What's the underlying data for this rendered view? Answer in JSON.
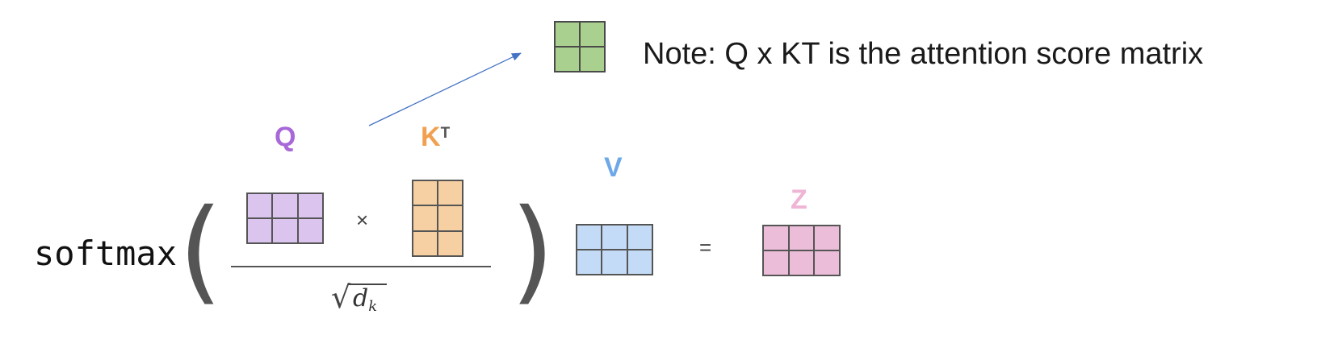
{
  "note": {
    "text": "Note: Q x KT is the attention score matrix",
    "matrix": {
      "rows": 2,
      "cols": 2,
      "color": "#a9d08e"
    }
  },
  "formula": {
    "function": "softmax",
    "multiply_symbol": "×",
    "equals_symbol": "=",
    "open_paren": "(",
    "close_paren": ")",
    "sqrt_symbol": "√",
    "denominator_var": "d",
    "denominator_sub": "k"
  },
  "matrices": {
    "q": {
      "label": "Q",
      "rows": 2,
      "cols": 3,
      "color": "#dbc5ef",
      "label_color": "#a868d8"
    },
    "k": {
      "label": "K",
      "label_sup": "T",
      "rows": 3,
      "cols": 2,
      "color": "#f6d0a2",
      "label_color": "#f0a050",
      "label_sup_color": "#555555"
    },
    "v": {
      "label": "V",
      "rows": 2,
      "cols": 3,
      "color": "#c3dbf6",
      "label_color": "#6fa8e8"
    },
    "z": {
      "label": "Z",
      "rows": 2,
      "cols": 3,
      "color": "#ecbdd8",
      "label_color": "#f0b4d4"
    }
  },
  "arrow_color": "#4472c4"
}
